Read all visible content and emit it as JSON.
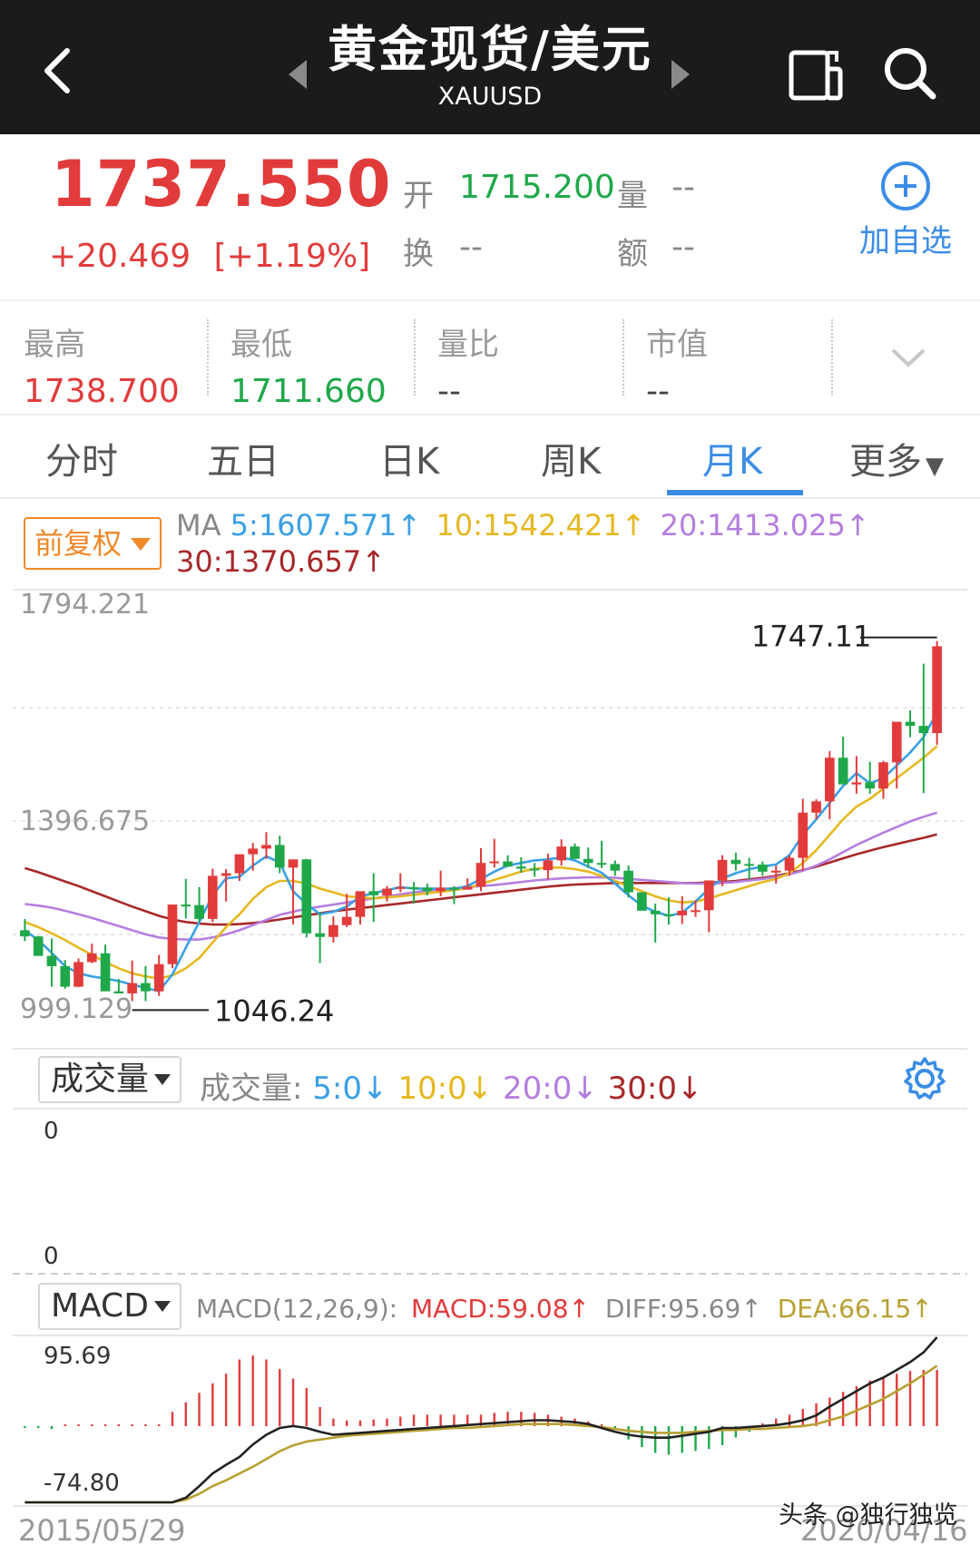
{
  "header": {
    "title": "黄金现货/美元",
    "subtitle": "XAUUSD"
  },
  "quote": {
    "price": "1737.550",
    "change": "+20.469",
    "change_pct": "[+1.19%]",
    "open_label": "开",
    "open_value": "1715.200",
    "volume_label": "量",
    "volume_value": "--",
    "turnover_label": "换",
    "turnover_value": "--",
    "amount_label": "额",
    "amount_value": "--",
    "add_label": "加自选"
  },
  "stats": [
    {
      "label": "最高",
      "value": "1738.700",
      "color": "#e23b3b"
    },
    {
      "label": "最低",
      "value": "1711.660",
      "color": "#1fa84a"
    },
    {
      "label": "量比",
      "value": "--",
      "color": "#444444"
    },
    {
      "label": "市值",
      "value": "--",
      "color": "#444444"
    }
  ],
  "tabs": [
    "分时",
    "五日",
    "日K",
    "周K",
    "月K",
    "更多"
  ],
  "active_tab": "月K",
  "adjust_label": "前复权",
  "ma_info": {
    "label": "MA",
    "ma5": "5:1607.571",
    "ma10": "10:1542.421",
    "ma20": "20:1413.025",
    "ma30": "30:1370.657"
  },
  "volume_panel": {
    "select_label": "成交量",
    "title": "成交量:",
    "ma5": "5:0",
    "ma10": "10:0",
    "ma20": "20:0",
    "ma30": "30:0",
    "top_tick": "0",
    "bottom_tick": "0"
  },
  "macd_panel": {
    "select_label": "MACD",
    "params": "MACD(12,26,9):",
    "macd": "MACD:59.08",
    "diff": "DIFF:95.69",
    "dea": "DEA:66.15",
    "top_tick": "95.69",
    "bottom_tick": "-74.80"
  },
  "dates": {
    "start": "2015/05/29",
    "end": "2020/04/16"
  },
  "watermark": "头条 @独行独览",
  "colors": {
    "up": "#e23b3b",
    "down": "#1fa84a",
    "ma5": "#3aa0e6",
    "ma10": "#e6b820",
    "ma20": "#b57ee0",
    "ma30": "#a8282a",
    "dea": "#b8a032",
    "accent": "#3a8de6"
  },
  "chart_data": {
    "type": "candlestick",
    "y_ticks": [
      "1794.221",
      "1396.675",
      "999.129"
    ],
    "ylim": [
      999.129,
      1794.221
    ],
    "x_range": [
      "2015/05/29",
      "2020/04/16"
    ],
    "annotations": [
      {
        "label": "1747.11",
        "value": 1747.11,
        "kind": "max"
      },
      {
        "label": "1046.24",
        "value": 1046.24,
        "kind": "min"
      }
    ],
    "candles": [
      [
        1184,
        1206,
        1163,
        1172
      ],
      [
        1172,
        1173,
        1141,
        1134
      ],
      [
        1134,
        1168,
        1074,
        1114
      ],
      [
        1114,
        1126,
        1070,
        1074
      ],
      [
        1074,
        1129,
        1073,
        1122
      ],
      [
        1122,
        1158,
        1120,
        1139
      ],
      [
        1139,
        1156,
        1077,
        1065
      ],
      [
        1065,
        1089,
        1063,
        1061
      ],
      [
        1061,
        1125,
        1046,
        1081
      ],
      [
        1081,
        1114,
        1046,
        1065
      ],
      [
        1065,
        1136,
        1056,
        1118
      ],
      [
        1118,
        1228,
        1110,
        1234
      ],
      [
        1234,
        1284,
        1207,
        1233
      ],
      [
        1233,
        1268,
        1200,
        1206
      ],
      [
        1206,
        1304,
        1200,
        1290
      ],
      [
        1290,
        1303,
        1240,
        1295
      ],
      [
        1295,
        1330,
        1280,
        1332
      ],
      [
        1332,
        1354,
        1300,
        1343
      ],
      [
        1343,
        1375,
        1323,
        1350
      ],
      [
        1350,
        1368,
        1295,
        1306
      ],
      [
        1306,
        1316,
        1195,
        1322
      ],
      [
        1322,
        1323,
        1170,
        1178
      ],
      [
        1178,
        1220,
        1120,
        1171
      ],
      [
        1171,
        1211,
        1160,
        1194
      ],
      [
        1194,
        1255,
        1190,
        1210
      ],
      [
        1210,
        1255,
        1195,
        1260
      ],
      [
        1260,
        1295,
        1200,
        1252
      ],
      [
        1252,
        1270,
        1240,
        1265
      ],
      [
        1265,
        1295,
        1258,
        1268
      ],
      [
        1268,
        1278,
        1236,
        1267
      ],
      [
        1267,
        1275,
        1252,
        1260
      ],
      [
        1260,
        1300,
        1250,
        1267
      ],
      [
        1267,
        1270,
        1235,
        1263
      ],
      [
        1263,
        1285,
        1270,
        1269
      ],
      [
        1269,
        1344,
        1260,
        1315
      ],
      [
        1315,
        1362,
        1306,
        1318
      ],
      [
        1318,
        1330,
        1307,
        1308
      ],
      [
        1308,
        1326,
        1296,
        1304
      ],
      [
        1304,
        1315,
        1288,
        1301
      ],
      [
        1301,
        1333,
        1283,
        1320
      ],
      [
        1320,
        1361,
        1310,
        1347
      ],
      [
        1347,
        1353,
        1334,
        1323
      ],
      [
        1323,
        1345,
        1305,
        1315
      ],
      [
        1315,
        1358,
        1305,
        1313
      ],
      [
        1313,
        1320,
        1290,
        1300
      ],
      [
        1300,
        1310,
        1248,
        1258
      ],
      [
        1258,
        1255,
        1225,
        1222
      ],
      [
        1222,
        1236,
        1160,
        1215
      ],
      [
        1215,
        1248,
        1195,
        1213
      ],
      [
        1213,
        1250,
        1196,
        1222
      ],
      [
        1222,
        1242,
        1210,
        1223
      ],
      [
        1223,
        1249,
        1180,
        1281
      ],
      [
        1281,
        1330,
        1270,
        1321
      ],
      [
        1321,
        1335,
        1300,
        1313
      ],
      [
        1313,
        1325,
        1283,
        1312
      ],
      [
        1312,
        1318,
        1290,
        1298
      ],
      [
        1298,
        1310,
        1275,
        1300
      ],
      [
        1300,
        1330,
        1290,
        1325
      ],
      [
        1325,
        1440,
        1300,
        1413
      ],
      [
        1413,
        1439,
        1400,
        1435
      ],
      [
        1435,
        1533,
        1400,
        1520
      ],
      [
        1520,
        1561,
        1490,
        1468
      ],
      [
        1468,
        1523,
        1450,
        1472
      ],
      [
        1472,
        1512,
        1450,
        1460
      ],
      [
        1460,
        1514,
        1440,
        1511
      ],
      [
        1511,
        1560,
        1460,
        1590
      ],
      [
        1590,
        1612,
        1560,
        1582
      ],
      [
        1582,
        1703,
        1451,
        1568
      ],
      [
        1568,
        1747.11,
        1545,
        1737
      ]
    ],
    "ma5": [
      1184,
      1165,
      1140,
      1114,
      1100,
      1094,
      1090,
      1085,
      1078,
      1072,
      1065,
      1098,
      1150,
      1200,
      1252,
      1285,
      1288,
      1310,
      1328,
      1316,
      1260,
      1235,
      1215,
      1220,
      1230,
      1250,
      1256,
      1262,
      1268,
      1265,
      1265,
      1265,
      1264,
      1270,
      1284,
      1298,
      1310,
      1315,
      1320,
      1322,
      1326,
      1320,
      1308,
      1296,
      1275,
      1252,
      1232,
      1220,
      1212,
      1218,
      1240,
      1265,
      1285,
      1295,
      1303,
      1308,
      1312,
      1330,
      1370,
      1400,
      1432,
      1465,
      1490,
      1470,
      1480,
      1505,
      1530,
      1560,
      1607.571
    ],
    "ma10": [
      1200,
      1190,
      1178,
      1165,
      1150,
      1136,
      1122,
      1110,
      1100,
      1094,
      1090,
      1096,
      1110,
      1130,
      1160,
      1190,
      1215,
      1245,
      1268,
      1280,
      1280,
      1275,
      1265,
      1258,
      1250,
      1248,
      1246,
      1248,
      1250,
      1253,
      1256,
      1259,
      1262,
      1266,
      1274,
      1282,
      1290,
      1298,
      1304,
      1306,
      1306,
      1303,
      1298,
      1290,
      1280,
      1270,
      1260,
      1250,
      1242,
      1238,
      1240,
      1246,
      1254,
      1262,
      1270,
      1278,
      1284,
      1295,
      1315,
      1340,
      1370,
      1400,
      1425,
      1440,
      1460,
      1480,
      1500,
      1520,
      1542.421
    ],
    "ma20": [
      1235,
      1232,
      1228,
      1222,
      1215,
      1208,
      1200,
      1192,
      1184,
      1176,
      1170,
      1167,
      1166,
      1166,
      1170,
      1176,
      1184,
      1194,
      1204,
      1214,
      1220,
      1226,
      1230,
      1234,
      1238,
      1242,
      1246,
      1250,
      1254,
      1258,
      1261,
      1264,
      1266,
      1268,
      1270,
      1272,
      1275,
      1278,
      1281,
      1283,
      1285,
      1286,
      1287,
      1287,
      1286,
      1284,
      1282,
      1280,
      1278,
      1276,
      1275,
      1275,
      1276,
      1278,
      1281,
      1284,
      1288,
      1293,
      1300,
      1310,
      1322,
      1336,
      1350,
      1362,
      1374,
      1385,
      1396,
      1405,
      1413.025
    ],
    "ma30": [
      1305,
      1297,
      1288,
      1279,
      1270,
      1260,
      1250,
      1240,
      1230,
      1221,
      1212,
      1205,
      1200,
      1197,
      1195,
      1195,
      1196,
      1198,
      1201,
      1205,
      1209,
      1213,
      1217,
      1221,
      1224,
      1227,
      1230,
      1233,
      1236,
      1239,
      1242,
      1245,
      1248,
      1251,
      1254,
      1257,
      1260,
      1263,
      1266,
      1269,
      1271,
      1273,
      1274,
      1275,
      1276,
      1276,
      1276,
      1276,
      1276,
      1276,
      1276,
      1277,
      1278,
      1280,
      1283,
      1286,
      1290,
      1295,
      1301,
      1308,
      1316,
      1324,
      1332,
      1339,
      1346,
      1352,
      1358,
      1364,
      1370.657
    ],
    "macd": {
      "hist": [
        -2,
        -2,
        -3,
        0,
        0,
        0,
        0,
        0,
        0,
        0,
        0,
        15,
        25,
        35,
        45,
        55,
        70,
        74,
        70,
        60,
        50,
        40,
        20,
        8,
        6,
        6,
        7,
        8,
        10,
        12,
        12,
        12,
        12,
        12,
        12,
        14,
        15,
        15,
        14,
        12,
        10,
        8,
        5,
        2,
        -4,
        -14,
        -22,
        -28,
        -30,
        -28,
        -26,
        -24,
        -20,
        -12,
        -6,
        3,
        8,
        12,
        18,
        24,
        30,
        36,
        42,
        48,
        52,
        55,
        58,
        59,
        59.08
      ],
      "diff": [
        -74.8,
        -74.8,
        -74.8,
        -74.8,
        -74.8,
        -74.8,
        -74.8,
        -74.8,
        -74.8,
        -74.8,
        -74.8,
        -74.8,
        -70,
        -58,
        -45,
        -36,
        -28,
        -15,
        -5,
        2,
        4,
        2,
        -2,
        -5,
        -4,
        -3,
        -2,
        -1,
        0,
        1,
        2,
        3,
        4,
        5,
        6,
        7,
        8,
        9,
        10,
        10,
        9,
        8,
        6,
        2,
        -2,
        -5,
        -7,
        -8,
        -8,
        -6,
        -4,
        -2,
        2,
        2,
        3,
        4,
        5,
        7,
        10,
        15,
        24,
        32,
        40,
        48,
        54,
        62,
        70,
        80,
        95.69
      ],
      "dea": [
        -74.8,
        -74.8,
        -74.8,
        -74.8,
        -74.8,
        -74.8,
        -74.8,
        -74.8,
        -74.8,
        -74.8,
        -74.8,
        -74.8,
        -72,
        -66,
        -58,
        -52,
        -45,
        -38,
        -30,
        -22,
        -16,
        -12,
        -10,
        -8,
        -6,
        -5,
        -4,
        -3,
        -2,
        -1,
        0,
        1,
        2,
        2,
        3,
        4,
        5,
        6,
        6,
        6,
        6,
        5,
        4,
        3,
        1,
        -1,
        -2,
        -3,
        -3,
        -3,
        -2,
        -1,
        0,
        0,
        1,
        1,
        2,
        3,
        4,
        6,
        10,
        14,
        20,
        26,
        32,
        40,
        48,
        57,
        66.15
      ]
    }
  }
}
